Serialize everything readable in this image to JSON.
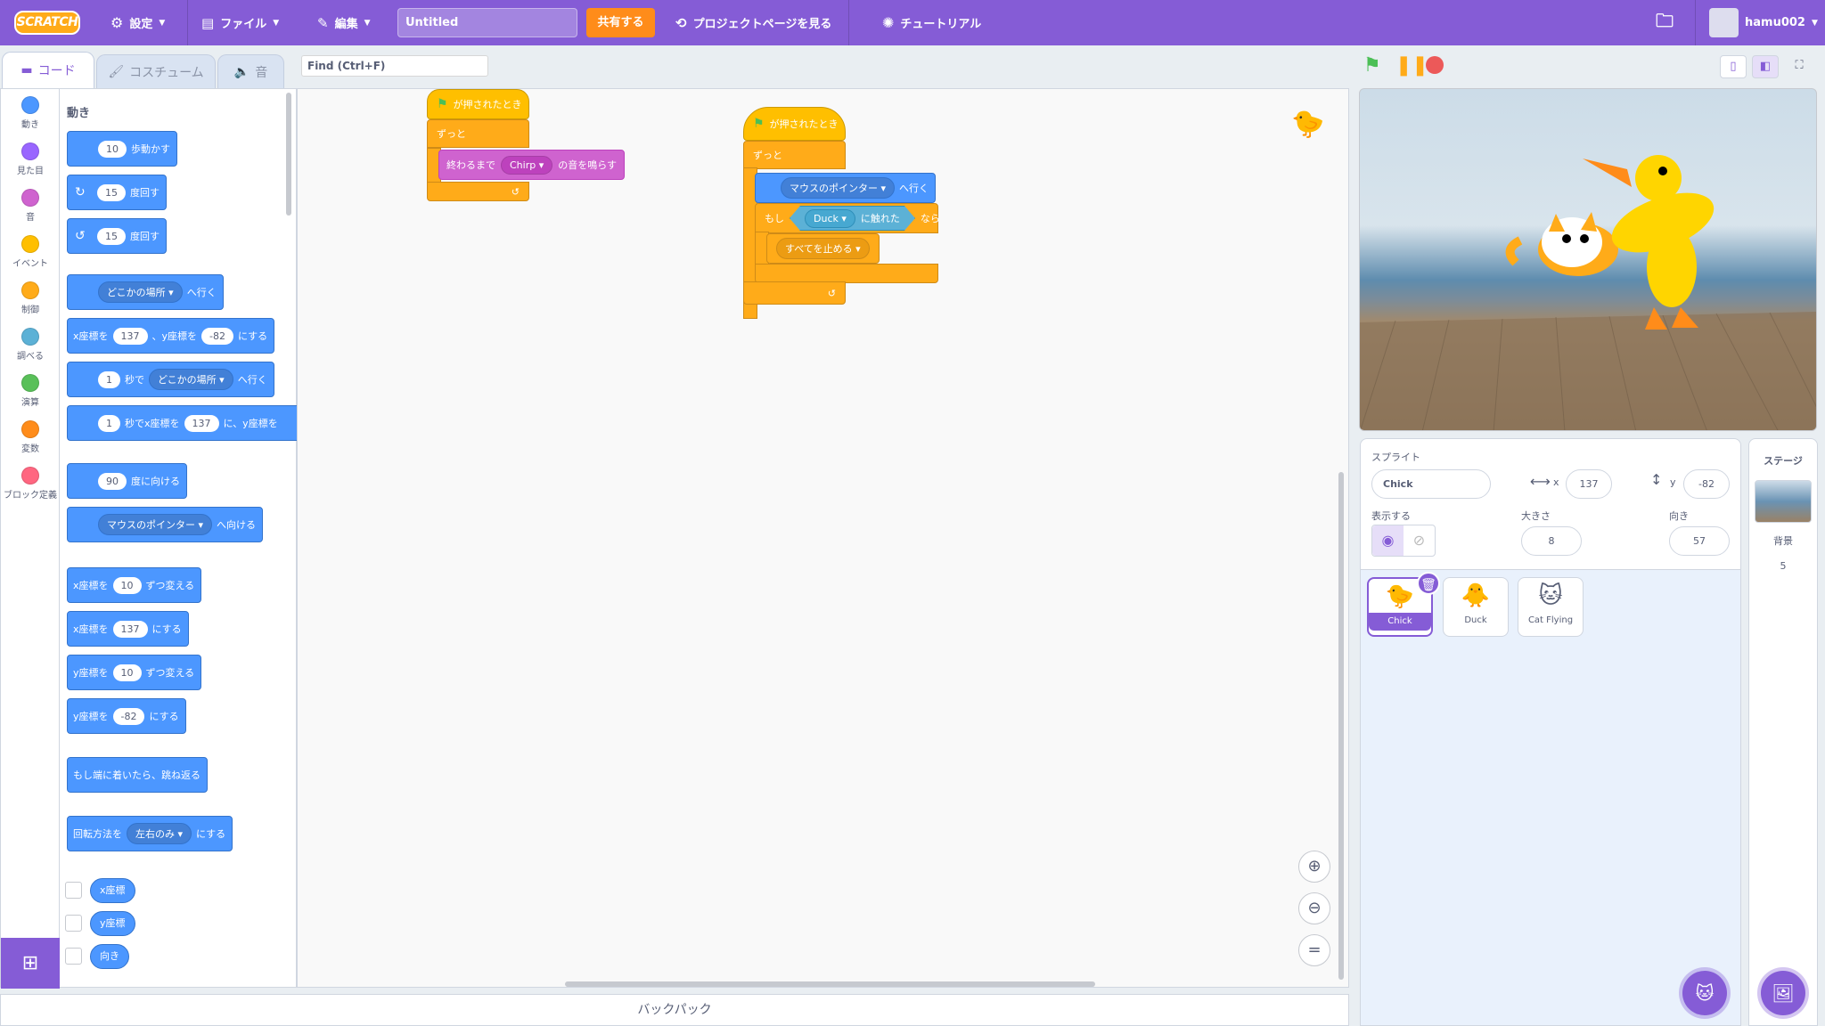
{
  "menu": {
    "logo": "SCRATCH",
    "settings": "設定",
    "file": "ファイル",
    "edit": "編集",
    "project_title": "Untitled",
    "share": "共有する",
    "project_page": "プロジェクトページを見る",
    "tutorial": "チュートリアル",
    "username": "hamu002"
  },
  "tabs": {
    "code": "コード",
    "costume": "コスチューム",
    "sound": "音"
  },
  "find_placeholder": "Find (Ctrl+F)",
  "categories": [
    {
      "label": "動き",
      "color": "#4c97ff"
    },
    {
      "label": "見た目",
      "color": "#9966ff"
    },
    {
      "label": "音",
      "color": "#cf63cf"
    },
    {
      "label": "イベント",
      "color": "#ffbf00"
    },
    {
      "label": "制御",
      "color": "#ffab19"
    },
    {
      "label": "調べる",
      "color": "#5cb1d6"
    },
    {
      "label": "演算",
      "color": "#59c059"
    },
    {
      "label": "変数",
      "color": "#ff8c1a"
    },
    {
      "label": "ブロック定義",
      "color": "#ff6680"
    }
  ],
  "palette": {
    "heading": "動き",
    "move": {
      "n": "10",
      "t": "歩動かす"
    },
    "turn_right": {
      "n": "15",
      "t": "度回す"
    },
    "turn_left": {
      "n": "15",
      "t": "度回す"
    },
    "goto": {
      "dd": "どこかの場所",
      "t": "へ行く"
    },
    "gotoxy": {
      "a": "x座標を",
      "x": "137",
      "b": "、y座標を",
      "y": "-82",
      "c": "にする"
    },
    "glide": {
      "n": "1",
      "a": "秒で",
      "dd": "どこかの場所",
      "t": "へ行く"
    },
    "glidexy": {
      "n": "1",
      "a": "秒でx座標を",
      "x": "137",
      "b": "に、y座標を"
    },
    "point_dir": {
      "n": "90",
      "t": "度に向ける"
    },
    "point_towards": {
      "dd": "マウスのポインター",
      "t": "へ向ける"
    },
    "change_x": {
      "a": "x座標を",
      "n": "10",
      "t": "ずつ変える"
    },
    "set_x": {
      "a": "x座標を",
      "n": "137",
      "t": "にする"
    },
    "change_y": {
      "a": "y座標を",
      "n": "10",
      "t": "ずつ変える"
    },
    "set_y": {
      "a": "y座標を",
      "n": "-82",
      "t": "にする"
    },
    "bounce": "もし端に着いたら、跳ね返る",
    "rotation": {
      "a": "回転方法を",
      "dd": "左右のみ",
      "t": "にする"
    },
    "rep_x": "x座標",
    "rep_y": "y座標",
    "rep_dir": "向き"
  },
  "script1": {
    "hat": "が押されたとき",
    "forever": "ずっと",
    "sound": {
      "a": "終わるまで",
      "dd": "Chirp",
      "t": "の音を鳴らす"
    }
  },
  "script2": {
    "hat": "が押されたとき",
    "forever": "ずっと",
    "goto": {
      "dd": "マウスのポインター",
      "t": "へ行く"
    },
    "if": "もし",
    "touch": {
      "dd": "Duck",
      "t": "に触れた"
    },
    "then": "なら",
    "stop": "すべてを止める"
  },
  "backpack": "バックパック",
  "sprite_info": {
    "label": "スプライト",
    "name": "Chick",
    "x_label": "x",
    "x": "137",
    "y_label": "y",
    "y": "-82",
    "show_label": "表示する",
    "size_label": "大きさ",
    "size": "8",
    "direction_label": "向き",
    "direction": "57"
  },
  "sprites": [
    {
      "name": "Chick"
    },
    {
      "name": "Duck"
    },
    {
      "name": "Cat Flying"
    }
  ],
  "stage_pane": {
    "label": "ステージ",
    "backdrop_label": "背景",
    "backdrop_count": "5"
  }
}
